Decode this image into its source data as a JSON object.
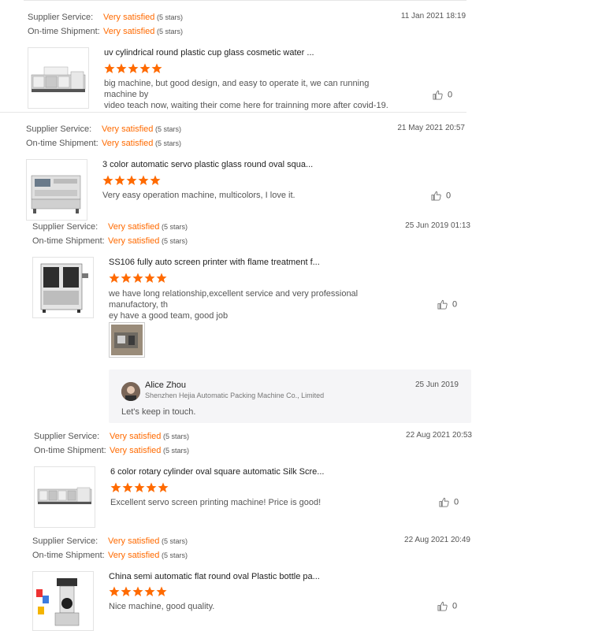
{
  "labels": {
    "supplier_service": "Supplier Service:",
    "ontime_shipment": "On-time Shipment:",
    "satisfied": "Very satisfied",
    "stars_count": "(5 stars)"
  },
  "accent_color": "#ff6a00",
  "reviews": [
    {
      "date": "11 Jan 2021 18:19",
      "product_title": "uv cylindrical round plastic cup glass cosmetic water ...",
      "rating": 5,
      "comment_lines": [
        "big machine, but good design, and easy to operate it, we can running machine by",
        "video teach now, waiting their come here for trainning more after covid-19."
      ],
      "likes": "0"
    },
    {
      "date": "21 May 2021 20:57",
      "product_title": "3 color automatic servo plastic glass round oval squa...",
      "rating": 5,
      "comment_lines": [
        "Very easy operation machine, multicolors, I love it."
      ],
      "likes": "0"
    },
    {
      "date": "25 Jun 2019 01:13",
      "product_title": "SS106 fully auto screen printer with flame treatment f...",
      "rating": 5,
      "comment_lines": [
        "we have long relationship,excellent service and very professional manufactory, th",
        "ey have a good team, good job"
      ],
      "likes": "0",
      "reply": {
        "name": "Alice Zhou",
        "company": "Shenzhen Hejia Automatic Packing Machine Co., Limited",
        "date": "25 Jun 2019",
        "text": "Let's keep in touch."
      }
    },
    {
      "date": "22 Aug 2021 20:53",
      "product_title": "6 color rotary cylinder oval square automatic Silk Scre...",
      "rating": 5,
      "comment_lines": [
        "Excellent servo screen printing machine! Price is good!"
      ],
      "likes": "0"
    },
    {
      "date": "22 Aug 2021 20:49",
      "product_title": "China semi automatic flat round oval Plastic bottle pa...",
      "rating": 5,
      "comment_lines": [
        "Nice machine, good quality."
      ],
      "likes": "0"
    }
  ]
}
